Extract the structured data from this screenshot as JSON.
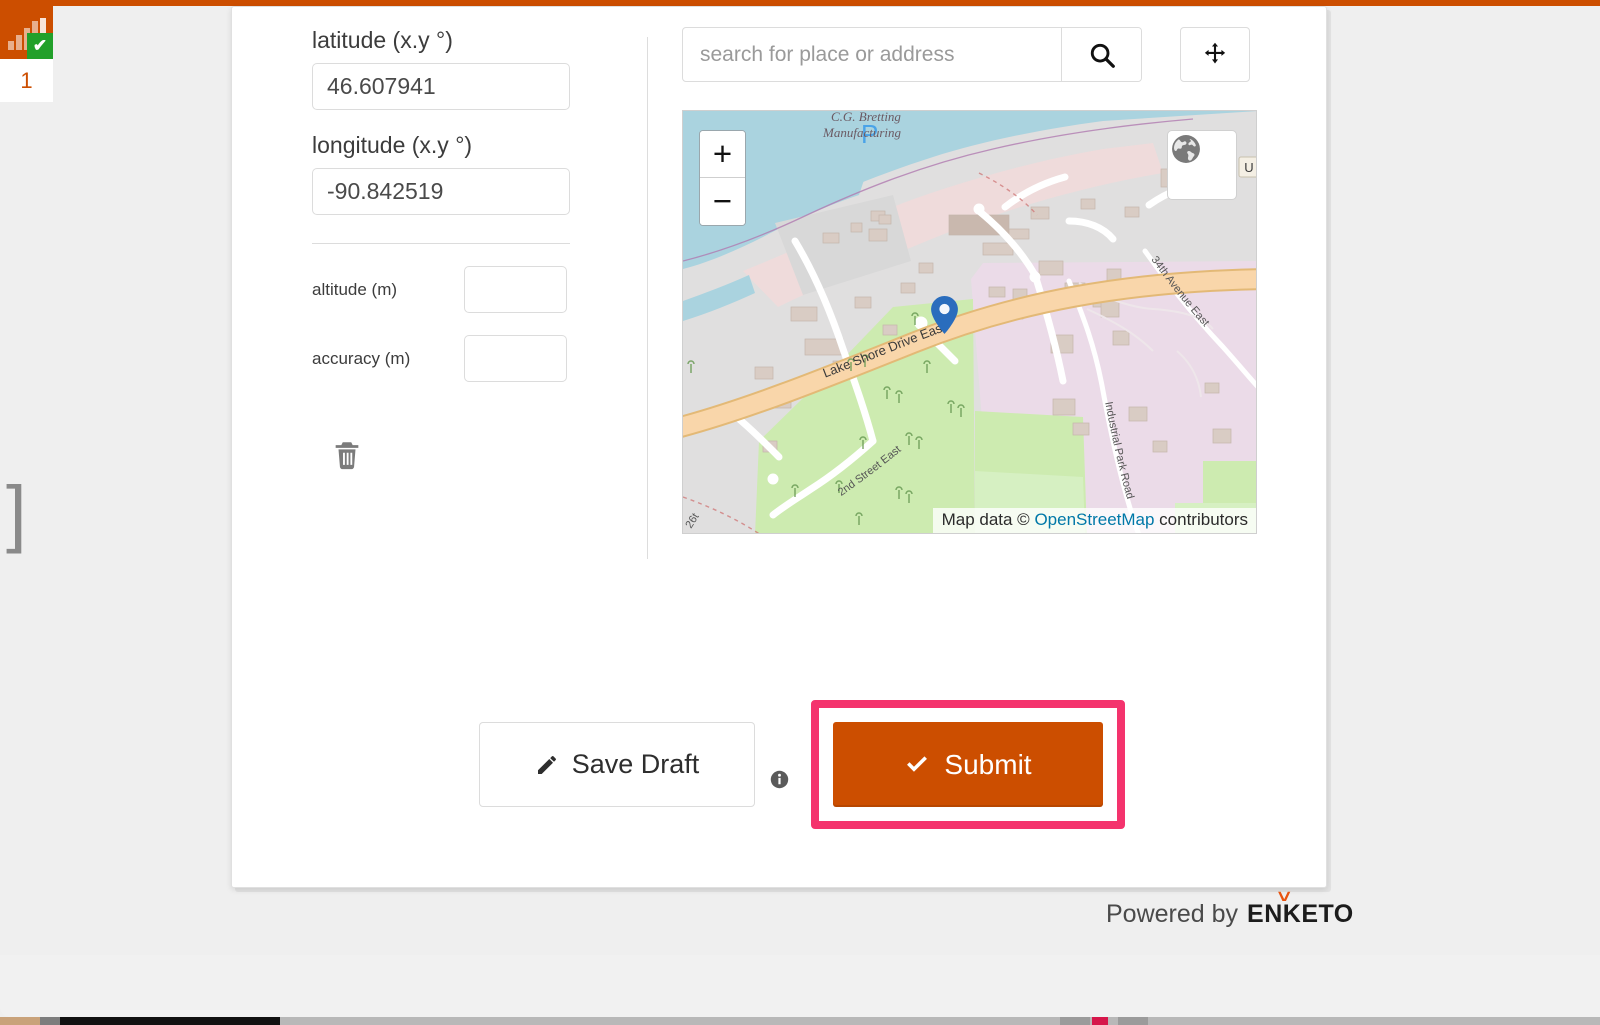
{
  "app": {
    "top_bar_color": "#cc4e00",
    "accent_color": "#cc4e00",
    "highlight_color": "#f4336d"
  },
  "nav_badge": {
    "icon": "bar-chart-icon",
    "check": "✔",
    "number": "1"
  },
  "handles": {
    "left": "]",
    "middle": "["
  },
  "form": {
    "fields": {
      "latitude": {
        "label": "latitude (x.y °)",
        "value": "46.607941",
        "placeholder": ""
      },
      "longitude": {
        "label": "longitude (x.y °)",
        "value": "-90.842519",
        "placeholder": ""
      },
      "altitude": {
        "label": "altitude (m)",
        "value": "",
        "placeholder": ""
      },
      "accuracy": {
        "label": "accuracy (m)",
        "value": "",
        "placeholder": ""
      }
    },
    "delete_icon": "trash-icon"
  },
  "search": {
    "placeholder": "search for place or address",
    "value": "",
    "search_icon": "search-icon",
    "locate_icon": "crosshairs-icon"
  },
  "map": {
    "zoom_in": "+",
    "zoom_out": "−",
    "layers_icon": "globe-icon",
    "marker_icon": "map-pin-icon",
    "marker_color": "#2a6dbd",
    "attribution_prefix": "Map data © ",
    "attribution_link": "OpenStreetMap",
    "attribution_suffix": " contributors",
    "labels": {
      "poi": "C.G. Bretting Manufacturing",
      "road_main": "Lake Shore Drive East",
      "road_2nd": "2nd Street East",
      "road_industrial": "Industrial Park Road",
      "road_34th": "34th Avenue East",
      "road_26th": "26t",
      "parking": "P",
      "shield": "U"
    },
    "colors": {
      "water": "#aad3df",
      "park": "#cdebb0",
      "grass": "#d6f0c2",
      "industrial": "#ebdbe8",
      "residential": "#e0dfdf",
      "retail": "#f1dada",
      "road_main": "#f9d6aa",
      "road_minor": "#ffffff",
      "building": "#d9ccc4"
    }
  },
  "actions": {
    "save_draft": {
      "label": "Save Draft",
      "icon": "pencil-icon"
    },
    "info": {
      "icon": "info-icon"
    },
    "submit": {
      "label": "Submit",
      "icon": "check-icon"
    }
  },
  "footer": {
    "powered_by": "Powered by",
    "brand": "ENKETO",
    "brand_tick": "˅"
  }
}
